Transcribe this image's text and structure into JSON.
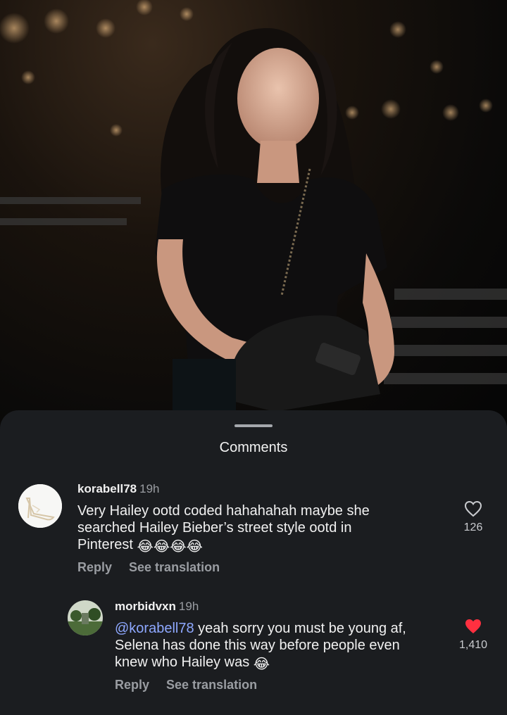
{
  "sheet": {
    "title": "Comments"
  },
  "comments": [
    {
      "username": "korabell78",
      "time": "19h",
      "text": "Very Hailey ootd coded hahahahah maybe she searched Hailey Bieber’s street style ootd in Pinterest",
      "emoji": "😂😂😂😂",
      "reply_label": "Reply",
      "translate_label": "See translation",
      "likes": "126",
      "liked": false,
      "avatar_icon": "high-heel-shoe-icon"
    },
    {
      "username": "morbidvxn",
      "time": "19h",
      "mention": "@korabell78",
      "text": " yeah sorry you must be young af, Selena has done this way before people even knew who Hailey was",
      "emoji": "😂",
      "reply_label": "Reply",
      "translate_label": "See translation",
      "likes": "1,410",
      "liked": true,
      "avatar_icon": "landscape-photo-icon"
    }
  ],
  "colors": {
    "sheet_bg": "#1b1d20",
    "liked_heart": "#ff3040",
    "mention": "#8ea8ff"
  }
}
